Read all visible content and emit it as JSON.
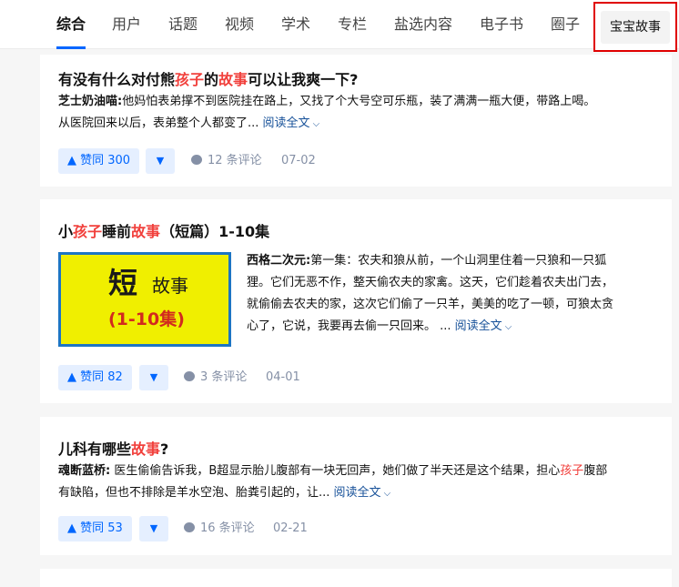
{
  "tabs": [
    {
      "label": "综合",
      "active": true
    },
    {
      "label": "用户"
    },
    {
      "label": "话题"
    },
    {
      "label": "视频"
    },
    {
      "label": "学术"
    },
    {
      "label": "专栏"
    },
    {
      "label": "盐选内容"
    },
    {
      "label": "电子书"
    },
    {
      "label": "圈子"
    },
    {
      "label": "宝宝故事",
      "highlighted": true
    }
  ],
  "results": [
    {
      "title_parts": [
        "有没有什么对付熊",
        "孩子",
        "的",
        "故事",
        "可以让我爽一下?"
      ],
      "author": "芝士奶油喵",
      "sep": ":",
      "excerpt_line1": "他妈怕表弟撑不到医院挂在路上，又找了个大号空可乐瓶，装了满满一瓶大便，带路上喝。",
      "excerpt_line2": "从医院回来以后，表弟整个人都变了...",
      "read_more": "阅读全文",
      "vote_label": "▲ 赞同 300",
      "comments": "12 条评论",
      "date": "07-02"
    },
    {
      "title_parts": [
        "小",
        "孩子",
        "睡前",
        "故事",
        "（短篇）1-10集"
      ],
      "thumbnail": {
        "big": "短",
        "small": "故事",
        "range": "(1-10集)"
      },
      "author": "西格二次元",
      "sep": ":",
      "excerpt_line1": "第一集：农夫和狼从前，一个山洞里住着一只狼和一只狐",
      "excerpt_line2": "狸。它们无恶不作，整天偷农夫的家禽。这天，它们趁着农夫出门去，",
      "excerpt_line3": "就偷偷去农夫的家，这次它们偷了一只羊，美美的吃了一顿，可狼太贪",
      "excerpt_line4": "心了，它说，我要再去偷一只回来。 ...",
      "read_more": "阅读全文",
      "vote_label": "▲ 赞同 82",
      "comments": "3 条评论",
      "date": "04-01"
    },
    {
      "title_parts": [
        "儿科有哪些",
        "故事",
        "?"
      ],
      "author": "魂断蓝桥",
      "sep": ":",
      "excerpt_line1a": " 医生偷偷告诉我，B超显示胎儿腹部有一块无回声，她们做了半天还是这个结果，担心",
      "excerpt_hl": "孩子",
      "excerpt_line1b": "腹部",
      "excerpt_line2": "有缺陷，但也不排除是羊水空泡、胎粪引起的，让...",
      "read_more": "阅读全文",
      "vote_label": "▲ 赞同 53",
      "comments": "16 条评论",
      "date": "02-21"
    }
  ],
  "icons": {
    "vote_down": "▼",
    "chevron": "chevron-down-icon",
    "comment": "comment-bubble-icon"
  },
  "colors": {
    "accent": "#0066ff",
    "highlight": "#f1403c",
    "link": "#175199",
    "meta": "#8590a6",
    "highlight_box": "#e00000"
  }
}
